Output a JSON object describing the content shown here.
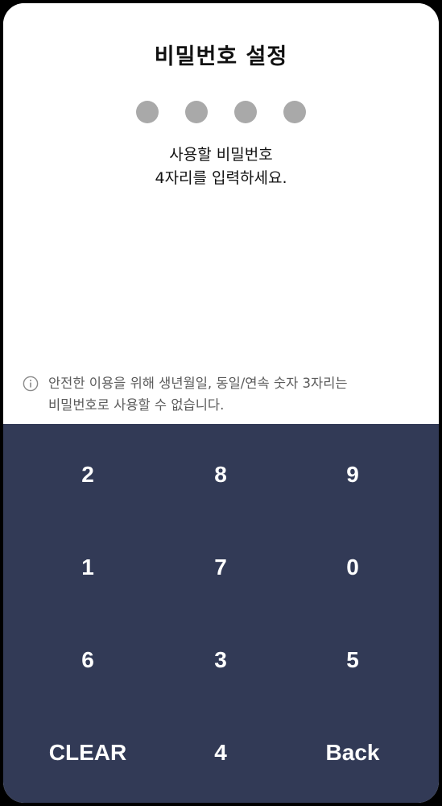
{
  "header": {
    "title": "비밀번호 설정"
  },
  "pin": {
    "length": 4,
    "entered": 0
  },
  "prompt": {
    "line1": "사용할 비밀번호",
    "line2": "4자리를 입력하세요."
  },
  "notice": {
    "icon": "info-icon",
    "line1": "안전한 이용을 위해 생년월일, 동일/연속 숫자 3자리는",
    "line2": "비밀번호로 사용할 수 없습니다."
  },
  "keypad": {
    "keys": [
      "2",
      "8",
      "9",
      "1",
      "7",
      "0",
      "6",
      "3",
      "5",
      "CLEAR",
      "4",
      "Back"
    ],
    "background": "#323a56"
  }
}
